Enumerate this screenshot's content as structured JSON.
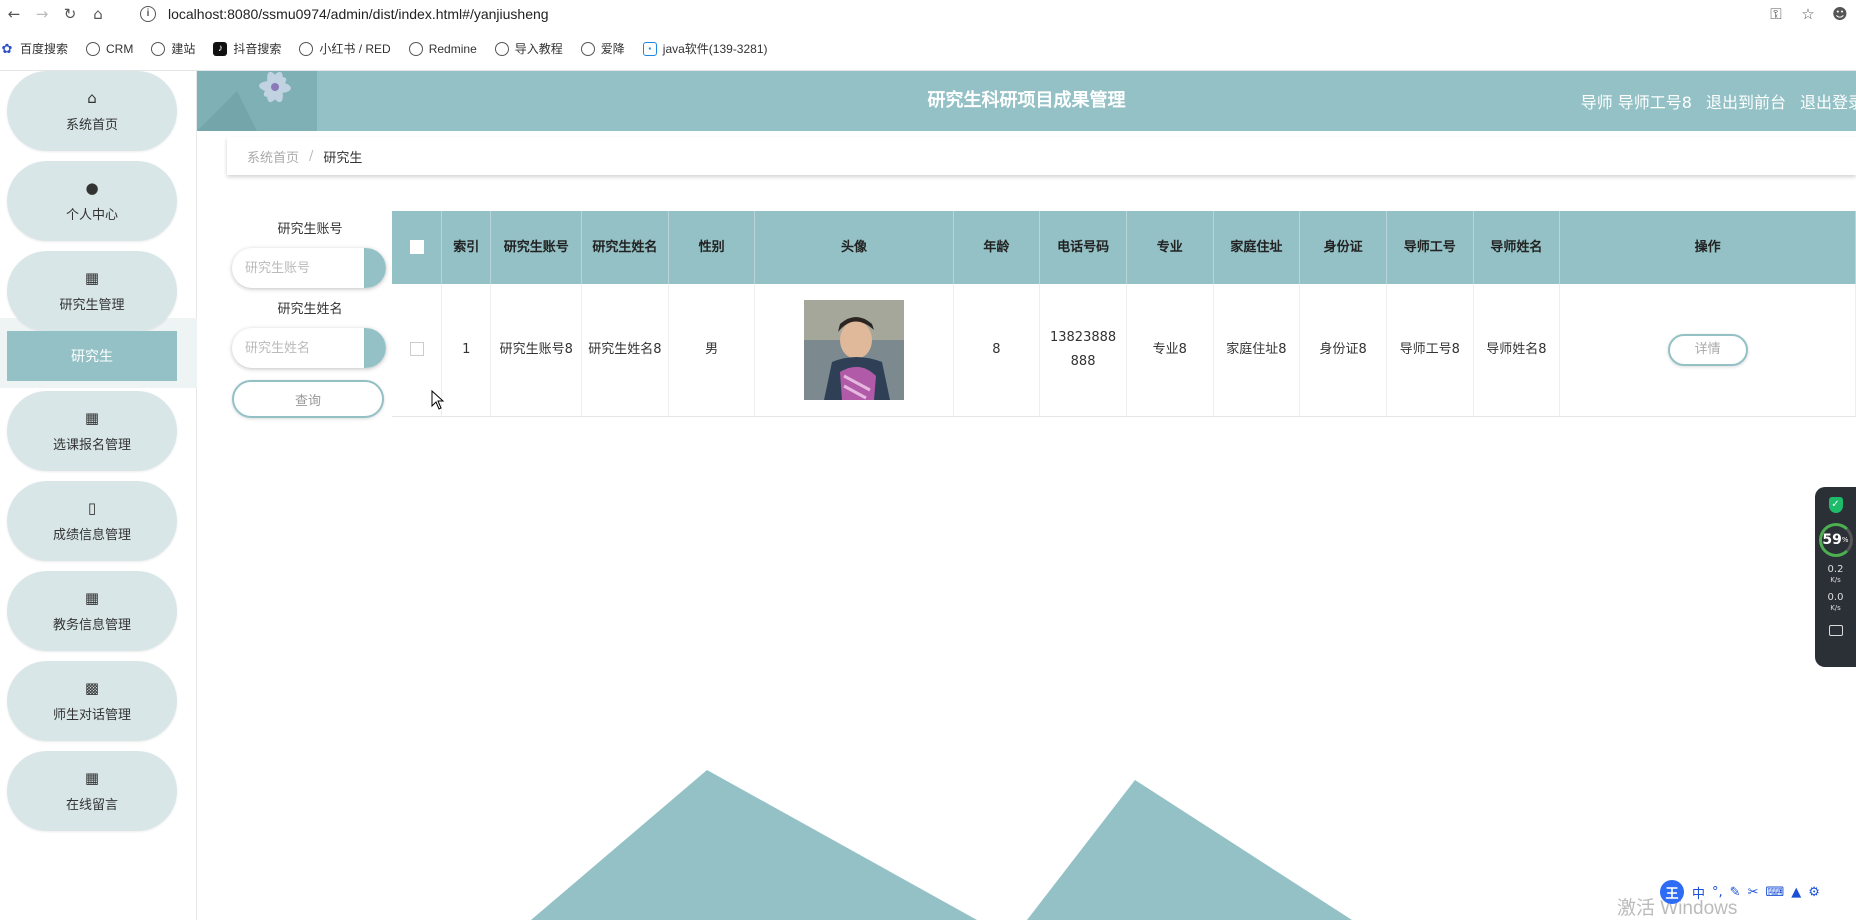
{
  "browser": {
    "url": "localhost:8080/ssmu0974/admin/dist/index.html#/yanjiusheng",
    "bookmarks": [
      {
        "label": "百度搜索",
        "icon": "paw-icon"
      },
      {
        "label": "CRM",
        "icon": "globe-icon"
      },
      {
        "label": "建站",
        "icon": "globe-icon"
      },
      {
        "label": "抖音搜索",
        "icon": "tiktok-icon"
      },
      {
        "label": "小红书 / RED",
        "icon": "globe-icon"
      },
      {
        "label": "Redmine",
        "icon": "globe-icon"
      },
      {
        "label": "导入教程",
        "icon": "globe-icon"
      },
      {
        "label": "爱降",
        "icon": "globe-icon"
      },
      {
        "label": "java软件(139-3281)",
        "icon": "tv-icon"
      }
    ]
  },
  "sidebar": {
    "items": [
      {
        "label": "系统首页",
        "icon": "home-icon"
      },
      {
        "label": "个人中心",
        "icon": "user-icon"
      },
      {
        "label": "研究生管理",
        "icon": "grid-icon"
      },
      {
        "label": "选课报名管理",
        "icon": "grid-icon"
      },
      {
        "label": "成绩信息管理",
        "icon": "clipboard-icon"
      },
      {
        "label": "教务信息管理",
        "icon": "grid-icon"
      },
      {
        "label": "师生对话管理",
        "icon": "bar-chart-icon"
      },
      {
        "label": "在线留言",
        "icon": "grid-icon"
      }
    ],
    "active_sub": "研究生"
  },
  "header": {
    "title": "研究生科研项目成果管理",
    "user": "导师 导师工号8",
    "front": "退出到前台",
    "logout": "退出登录"
  },
  "breadcrumb": {
    "home": "系统首页",
    "sep": "/",
    "current": "研究生"
  },
  "search": {
    "account_label": "研究生账号",
    "account_placeholder": "研究生账号",
    "name_label": "研究生姓名",
    "name_placeholder": "研究生姓名",
    "query_button": "查询"
  },
  "table": {
    "headers": [
      "索引",
      "研究生账号",
      "研究生姓名",
      "性别",
      "头像",
      "年龄",
      "电话号码",
      "专业",
      "家庭住址",
      "身份证",
      "导师工号",
      "导师姓名",
      "操作"
    ],
    "rows": [
      {
        "index": "1",
        "account": "研究生账号8",
        "name": "研究生姓名8",
        "gender": "男",
        "age": "8",
        "phone": "13823888888",
        "major": "专业8",
        "address": "家庭住址8",
        "id_card": "身份证8",
        "tutor_id": "导师工号8",
        "tutor_name": "导师姓名8",
        "action": "详情"
      }
    ]
  },
  "widget": {
    "percent": "59",
    "percent_unit": "%",
    "up": "0.2",
    "down": "0.0",
    "unit": "K/s"
  },
  "watermark": "激活 Windows",
  "colors": {
    "accent": "#93c1c5",
    "sidebar_item": "#d8e6e8"
  }
}
